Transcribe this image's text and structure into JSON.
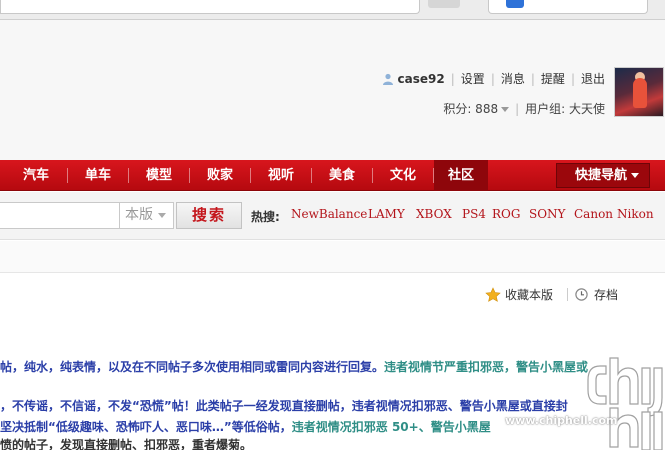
{
  "user": {
    "username": "case92",
    "links": [
      "设置",
      "消息",
      "提醒",
      "退出"
    ],
    "points_label": "积分: 888",
    "group_label": "用户组: 大天使"
  },
  "nav": {
    "items": [
      "汽车",
      "单车",
      "模型",
      "败家",
      "视听",
      "美食",
      "文化",
      "社区"
    ],
    "active": "社区",
    "quick_nav": "快捷导航"
  },
  "search": {
    "scope": "本版",
    "button": "搜索",
    "hot_label": "热搜:",
    "hot_terms": [
      "NewBalance",
      "LAMY",
      "XBOX",
      "PS4",
      "ROG",
      "SONY",
      "Canon",
      "Nikon"
    ]
  },
  "toolbar": {
    "favorite": "收藏本版",
    "archive": "存档"
  },
  "rules": [
    {
      "seg": [
        {
          "text": "帖，纯水，纯表情，以及在不同帖子多次使用相同或雷同内容进行回复。",
          "color": "blue"
        },
        {
          "text": "违者视情节严重扣邪恶，警告小黑屋或",
          "color": "teal"
        }
      ]
    },
    {
      "seg": [
        {
          "text": "，不传谣，不信谣，不发“恐慌”帖！此类帖子一经发现直接删帖，违者视情况扣邪恶、警告小黑屋或直接封",
          "color": "blue"
        }
      ]
    },
    {
      "seg": [
        {
          "text": "坚决抵制“低级趣味、恐怖吓人、恶口味…”等低俗帖，",
          "color": "blue"
        },
        {
          "text": "违者视情况扣邪恶 50+、警告小黑屋",
          "color": "teal"
        }
      ]
    },
    {
      "seg": [
        {
          "text": "愤的帖子，发现直接删帖、扣邪恶，重者爆菊。",
          "color": "dark"
        }
      ]
    }
  ],
  "watermark": {
    "url": "www.chiphell.com"
  },
  "colors": {
    "nav_red": "#c4161c",
    "hot_link": "#b3141a",
    "rule_blue": "#2b3fa8",
    "rule_teal": "#2f8e86"
  }
}
